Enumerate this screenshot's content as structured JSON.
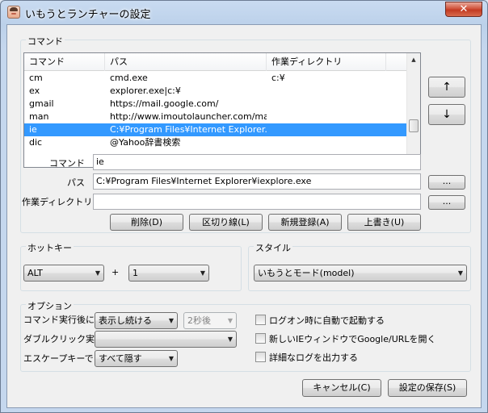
{
  "window": {
    "title": "いもうとランチャーの設定",
    "close_glyph": "✕"
  },
  "commands_group": {
    "label": "コマンド",
    "columns": [
      "コマンド",
      "パス",
      "作業ディレクトリ"
    ],
    "rows": [
      {
        "name": "cm",
        "path": "cmd.exe",
        "workdir": "c:¥",
        "selected": false
      },
      {
        "name": "ex",
        "path": "explorer.exe|c:¥",
        "workdir": "",
        "selected": false
      },
      {
        "name": "gmail",
        "path": "https://mail.google.com/",
        "workdir": "",
        "selected": false
      },
      {
        "name": "man",
        "path": "http://www.imoutolauncher.com/ma...",
        "workdir": "",
        "selected": false
      },
      {
        "name": "ie",
        "path": "C:¥Program Files¥Internet Explorer...",
        "workdir": "",
        "selected": true
      },
      {
        "name": "dic",
        "path": "@Yahoo辞書検索",
        "workdir": "",
        "selected": false
      }
    ],
    "move_up": "↑",
    "move_down": "↓",
    "command_label": "コマンド",
    "command_value": "ie",
    "path_label": "パス",
    "path_value": "C:¥Program Files¥Internet Explorer¥iexplore.exe",
    "workdir_label": "作業ディレクトリ",
    "workdir_value": "",
    "browse": "...",
    "buttons": {
      "delete": "削除(D)",
      "separator": "区切り線(L)",
      "new": "新規登録(A)",
      "overwrite": "上書き(U)"
    }
  },
  "hotkey_group": {
    "label": "ホットキー",
    "modifier": "ALT",
    "plus": "+",
    "key": "1"
  },
  "style_group": {
    "label": "スタイル",
    "value": "いもうとモード(model)"
  },
  "options_group": {
    "label": "オプション",
    "after_exec_label": "コマンド実行後に",
    "after_exec_value": "表示し続ける",
    "delay_value": "2秒後",
    "double_click_label": "ダブルクリック実行",
    "double_click_value": "",
    "escape_label": "エスケープキーで",
    "escape_value": "すべて隠す",
    "checks": [
      "ログオン時に自動で起動する",
      "新しいIEウィンドウでGoogle/URLを開く",
      "詳細なログを出力する"
    ]
  },
  "footer": {
    "cancel": "キャンセル(C)",
    "save": "設定の保存(S)"
  },
  "icons": {
    "dropdown": "▼",
    "scroll_up": "▲",
    "scroll_down": "▼"
  }
}
